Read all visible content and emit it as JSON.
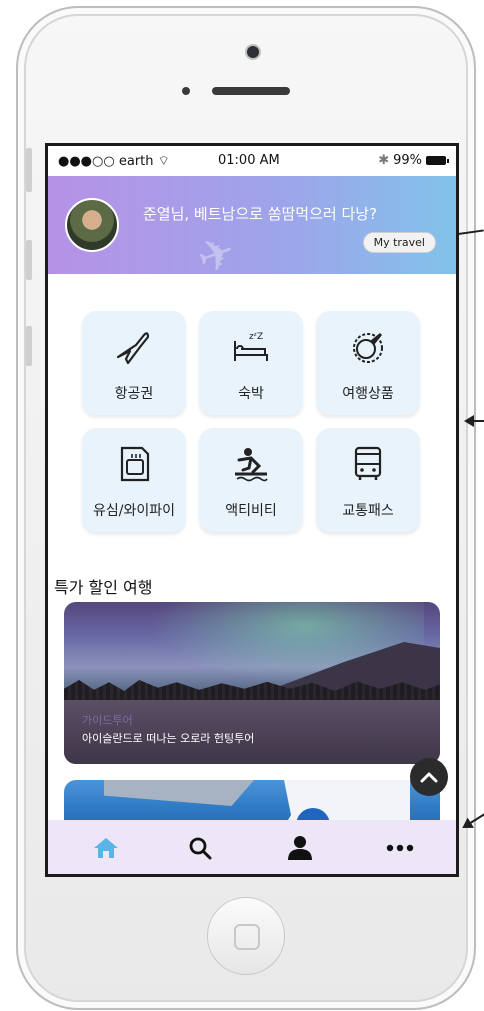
{
  "status_bar": {
    "carrier": "●●●○○ earth",
    "time": "01:00 AM",
    "battery": "99%"
  },
  "banner": {
    "greeting": "준열님, 베트남으로 쏨땀먹으러 다낭?",
    "my_travel_label": "My travel"
  },
  "categories": [
    {
      "label": "항공권",
      "icon": "airplane-icon"
    },
    {
      "label": "숙박",
      "icon": "bed-icon"
    },
    {
      "label": "여행상품",
      "icon": "globe-plane-icon"
    },
    {
      "label": "유심/와이파이",
      "icon": "sim-card-icon"
    },
    {
      "label": "액티비티",
      "icon": "surfing-icon"
    },
    {
      "label": "교통패스",
      "icon": "bus-icon"
    }
  ],
  "deals": {
    "section_title": "특가 할인 여행",
    "cards": [
      {
        "tag": "가이드투어",
        "description": "아이슬란드로 떠나는 오로라 헌팅투어"
      }
    ]
  },
  "tab_bar": {
    "tabs": [
      "home-icon",
      "search-icon",
      "profile-icon",
      "more-icon"
    ],
    "active_color": "#5ab4e5"
  }
}
